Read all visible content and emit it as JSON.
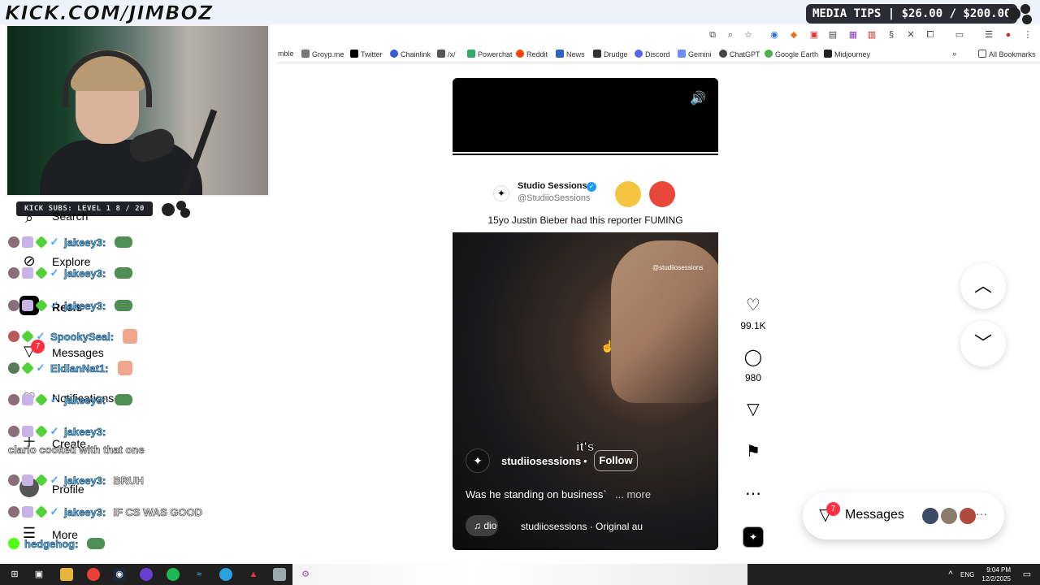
{
  "overlay": {
    "channel": "KICK.COM/JIMBOZ",
    "media_tips": "MEDIA TIPS | $26.00 / $200.00",
    "kick_subs": "KICK SUBS: LEVEL 1  8 / 20"
  },
  "bookmarks": [
    "mble",
    "Groyp.me",
    "Twitter",
    "Chainlink",
    "/x/",
    "Powerchat",
    "Reddit",
    "News",
    "Drudge",
    "Discord",
    "Gemini",
    "ChatGPT",
    "Google Earth",
    "Midjourney"
  ],
  "bookmarks_all": "All Bookmarks",
  "nav": {
    "search": "Search",
    "explore": "Explore",
    "reels": "Reels",
    "messages": "Messages",
    "messages_badge": "7",
    "notifications": "Notifications",
    "create": "Create",
    "profile": "Profile",
    "more": "More"
  },
  "chat": [
    {
      "name": "jakeey3:",
      "msg": ""
    },
    {
      "name": "jakeey3:",
      "msg": ""
    },
    {
      "name": "jakeey3:",
      "msg": ""
    },
    {
      "name": "SpookySeal:",
      "msg": ""
    },
    {
      "name": "EldianNat1:",
      "msg": ""
    },
    {
      "name": "jakeey3:",
      "msg": ""
    },
    {
      "name": "jakeey3:",
      "msg": ""
    },
    {
      "name": "jakeey3:",
      "msg": "BRUH"
    },
    {
      "name": "jakeey3:",
      "msg": "IF CS WAS GOOD"
    },
    {
      "name": "hedgehog:",
      "msg": ""
    }
  ],
  "chat_line": "clario cooked with that one",
  "reel": {
    "post_name": "Studio Sessions",
    "post_handle": "@StudiioSessions",
    "post_caption": "15yo Justin Bieber had this reporter FUMING",
    "watermark": "@studiiosessions",
    "subtitle": "it's",
    "user": "studiiosessions",
    "dot": "•",
    "follow": "Follow",
    "description": "Was he standing on business`",
    "more": "... more",
    "audio_pill": "♫ dio",
    "audio_text": "studiiosessions · Original au"
  },
  "actions": {
    "likes": "99.1K",
    "comments": "980"
  },
  "messages_pill": {
    "label": "Messages",
    "badge": "7",
    "more": "···"
  },
  "taskbar": {
    "lang": "ENG",
    "time": "9:04 PM",
    "date": "12/2/2025"
  },
  "icons": {
    "mute": "speaker-icon",
    "like": "heart-icon",
    "comment": "comment-icon",
    "share": "send-icon",
    "save": "bookmark-icon",
    "options": "more-icon",
    "prev": "chevron-up-icon",
    "next": "chevron-down-icon"
  },
  "colors": {
    "badge_red": "#ff3040",
    "chat_name": "#5ec8ff",
    "verified": "#1d9bf0"
  }
}
